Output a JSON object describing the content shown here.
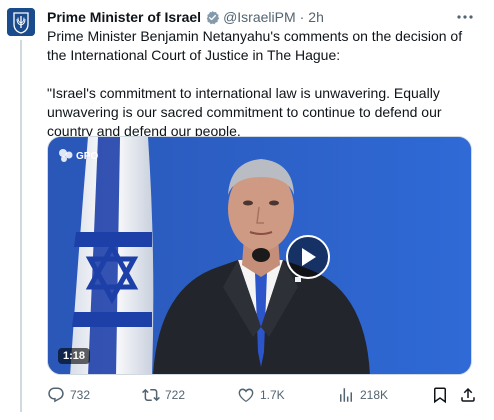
{
  "post": {
    "author_name": "Prime Minister of Israel",
    "handle": "@IsraeliPM",
    "separator": "·",
    "time": "2h",
    "avatar_icon": "israel-emblem-icon",
    "verified_icon": "verified-gray-badge-icon",
    "more_icon": "more-horizontal-icon",
    "text_paragraphs": [
      "Prime Minister Benjamin Netanyahu's comments on the decision of the International Court of Justice in The Hague:",
      "\"Israel's commitment to international law is unwavering. Equally unwavering is our sacred commitment to continue to defend our country and defend our people."
    ]
  },
  "media": {
    "watermark": "GPO",
    "duration": "1:18",
    "play_icon": "play-icon",
    "colors": {
      "backdrop": "#2f63c9",
      "flag_blue": "#1d3fa8"
    }
  },
  "actions": {
    "replies": "732",
    "reposts": "722",
    "likes": "1.7K",
    "views": "218K",
    "icons": [
      "reply-icon",
      "repost-icon",
      "like-icon",
      "views-icon",
      "bookmark-icon",
      "share-icon"
    ]
  },
  "colors": {
    "text": "#0f1419",
    "secondary": "#536471",
    "verified_badge": "#829aab"
  }
}
